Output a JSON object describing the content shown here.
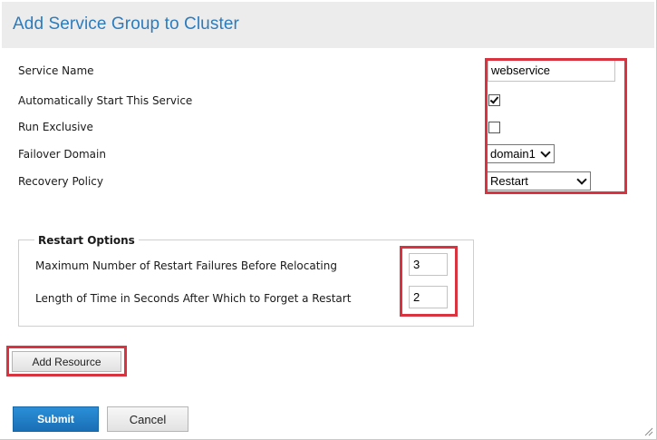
{
  "header": {
    "title": "Add Service Group to Cluster"
  },
  "form": {
    "service_name": {
      "label": "Service Name",
      "value": "webservice"
    },
    "auto_start": {
      "label": "Automatically Start This Service",
      "checked": true
    },
    "run_exclusive": {
      "label": "Run Exclusive",
      "checked": false
    },
    "failover_domain": {
      "label": "Failover Domain",
      "value": "domain1"
    },
    "recovery_policy": {
      "label": "Recovery Policy",
      "value": "Restart"
    }
  },
  "restart_options": {
    "legend": "Restart Options",
    "max_failures": {
      "label": "Maximum Number of Restart Failures Before Relocating",
      "value": "3"
    },
    "forget_time": {
      "label": "Length of Time in Seconds After Which to Forget a Restart",
      "value": "2"
    }
  },
  "buttons": {
    "add_resource": "Add Resource",
    "submit": "Submit",
    "cancel": "Cancel"
  },
  "colors": {
    "title": "#2b7cbf",
    "highlight": "#d9333f",
    "submit": "#1a7cc4"
  }
}
